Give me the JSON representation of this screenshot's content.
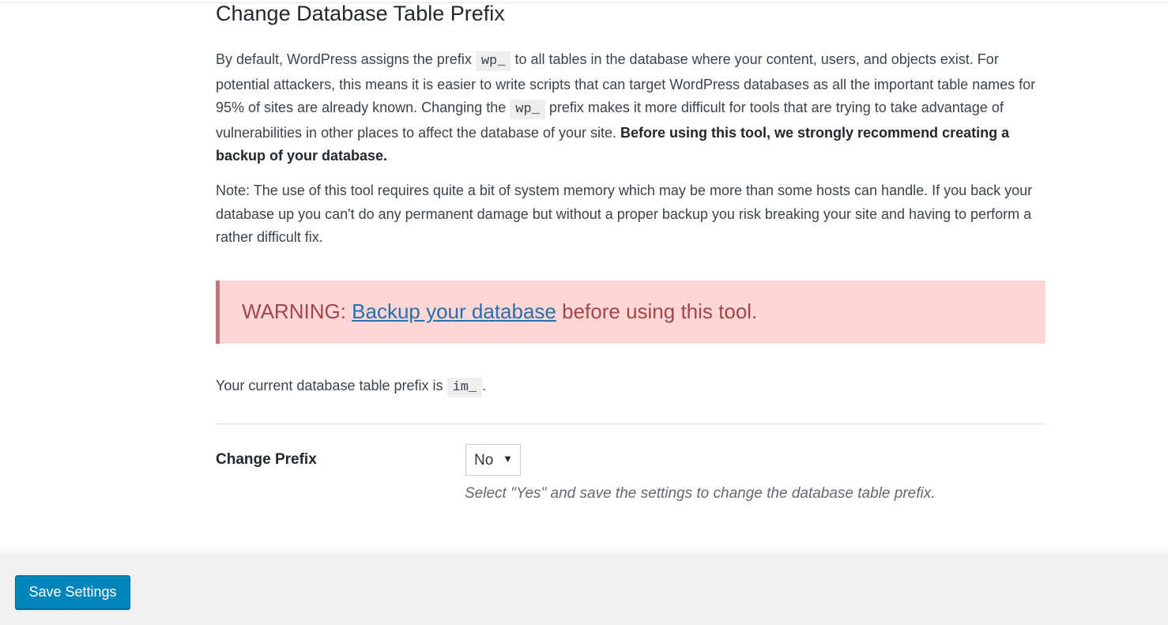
{
  "section": {
    "title": "Change Database Table Prefix",
    "intro": {
      "part1": "By default, WordPress assigns the prefix",
      "code1": "wp_",
      "part2": "to all tables in the database where your content, users, and objects exist. For potential attackers, this means it is easier to write scripts that can target WordPress databases as all the important table names for 95% of sites are already known. Changing the",
      "code2": "wp_",
      "part3": "prefix makes it more difficult for tools that are trying to take advantage of vulnerabilities in other places to affect the database of your site.",
      "bold": "Before using this tool, we strongly recommend creating a backup of your database."
    },
    "note": "Note: The use of this tool requires quite a bit of system memory which may be more than some hosts can handle. If you back your database up you can't do any permanent damage but without a proper backup you risk breaking your site and having to perform a rather difficult fix.",
    "warning": {
      "prefix": "WARNING:",
      "link": "Backup your database",
      "suffix": "before using this tool."
    },
    "current_prefix": {
      "text": "Your current database table prefix is",
      "code": "im_",
      "end": "."
    }
  },
  "field": {
    "label": "Change Prefix",
    "selected": "No",
    "description": "Select \"Yes\" and save the settings to change the database table prefix."
  },
  "footer": {
    "save_label": "Save Settings"
  },
  "icons": {
    "select_arrow": "triangle-down-icon"
  },
  "colors": {
    "warning_bg": "#ffd6d6",
    "warning_border": "#c0767b",
    "warning_text": "#a24647",
    "link": "#2271b1",
    "button_bg": "#0085ba"
  }
}
